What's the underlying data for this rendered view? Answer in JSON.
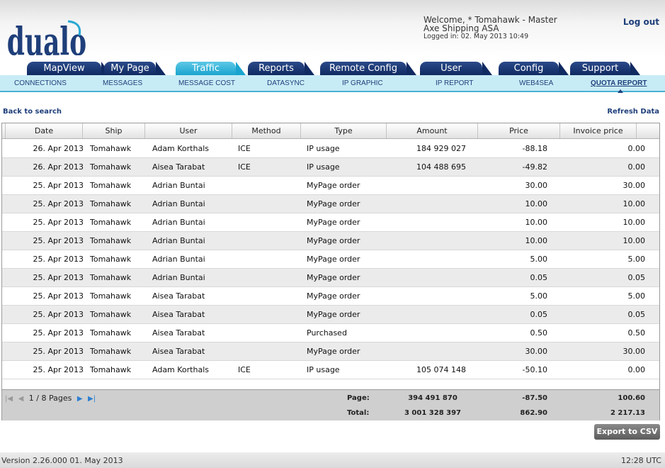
{
  "header": {
    "welcome_line1": "Welcome, * Tomahawk - Master",
    "welcome_line2": "Axe Shipping ASA",
    "welcome_line3": "Logged in: 02. May 2013 10:49",
    "logout": "Log out",
    "logo_text": "dualog"
  },
  "tabs": [
    {
      "label": "MapView"
    },
    {
      "label": "My Page"
    },
    {
      "label": "Traffic"
    },
    {
      "label": "Reports"
    },
    {
      "label": "Remote Config"
    },
    {
      "label": "User"
    },
    {
      "label": "Config"
    },
    {
      "label": "Support"
    }
  ],
  "subnav": [
    {
      "label": "CONNECTIONS"
    },
    {
      "label": "MESSAGES"
    },
    {
      "label": "MESSAGE COST"
    },
    {
      "label": "DATASYNC"
    },
    {
      "label": "IP GRAPHIC"
    },
    {
      "label": "IP REPORT"
    },
    {
      "label": "WEB4SEA"
    },
    {
      "label": "QUOTA REPORT"
    }
  ],
  "links": {
    "back": "Back to search",
    "refresh": "Refresh Data"
  },
  "table": {
    "headers": [
      "Date",
      "Ship",
      "User",
      "Method",
      "Type",
      "Amount",
      "Price",
      "Invoice price"
    ],
    "rows": [
      [
        "26. Apr 2013",
        "Tomahawk",
        "Adam Korthals",
        "ICE",
        "IP usage",
        "184 929 027",
        "-88.18",
        "0.00"
      ],
      [
        "26. Apr 2013",
        "Tomahawk",
        "Aisea Tarabat",
        "ICE",
        "IP usage",
        "104 488 695",
        "-49.82",
        "0.00"
      ],
      [
        "25. Apr 2013",
        "Tomahawk",
        "Adrian Buntai",
        "",
        "MyPage order",
        "",
        "30.00",
        "30.00"
      ],
      [
        "25. Apr 2013",
        "Tomahawk",
        "Adrian Buntai",
        "",
        "MyPage order",
        "",
        "10.00",
        "10.00"
      ],
      [
        "25. Apr 2013",
        "Tomahawk",
        "Adrian Buntai",
        "",
        "MyPage order",
        "",
        "10.00",
        "10.00"
      ],
      [
        "25. Apr 2013",
        "Tomahawk",
        "Adrian Buntai",
        "",
        "MyPage order",
        "",
        "10.00",
        "10.00"
      ],
      [
        "25. Apr 2013",
        "Tomahawk",
        "Adrian Buntai",
        "",
        "MyPage order",
        "",
        "5.00",
        "5.00"
      ],
      [
        "25. Apr 2013",
        "Tomahawk",
        "Adrian Buntai",
        "",
        "MyPage order",
        "",
        "0.05",
        "0.05"
      ],
      [
        "25. Apr 2013",
        "Tomahawk",
        "Aisea Tarabat",
        "",
        "MyPage order",
        "",
        "5.00",
        "5.00"
      ],
      [
        "25. Apr 2013",
        "Tomahawk",
        "Aisea Tarabat",
        "",
        "MyPage order",
        "",
        "0.05",
        "0.05"
      ],
      [
        "25. Apr 2013",
        "Tomahawk",
        "Aisea Tarabat",
        "",
        "Purchased",
        "",
        "0.50",
        "0.50"
      ],
      [
        "25. Apr 2013",
        "Tomahawk",
        "Aisea Tarabat",
        "",
        "MyPage order",
        "",
        "30.00",
        "30.00"
      ],
      [
        "25. Apr 2013",
        "Tomahawk",
        "Adam Korthals",
        "ICE",
        "IP usage",
        "105 074 148",
        "-50.10",
        "0.00"
      ]
    ]
  },
  "pager": {
    "text": "1 / 8 Pages",
    "page_label": "Page:",
    "page_amount": "394 491 870",
    "page_price": "-87.50",
    "page_invoice": "100.60",
    "total_label": "Total:",
    "total_amount": "3 001 328 397",
    "total_price": "862.90",
    "total_invoice": "2 217.13"
  },
  "export": "Export to CSV",
  "footer": {
    "version": "Version 2.26.000 01. May 2013",
    "time": "12:28 UTC"
  },
  "colors": {
    "tab": "#102a62",
    "tab_active": "#1aa4cf",
    "subnav_bg": "#c8ecf6",
    "link": "#1f3f7a"
  }
}
